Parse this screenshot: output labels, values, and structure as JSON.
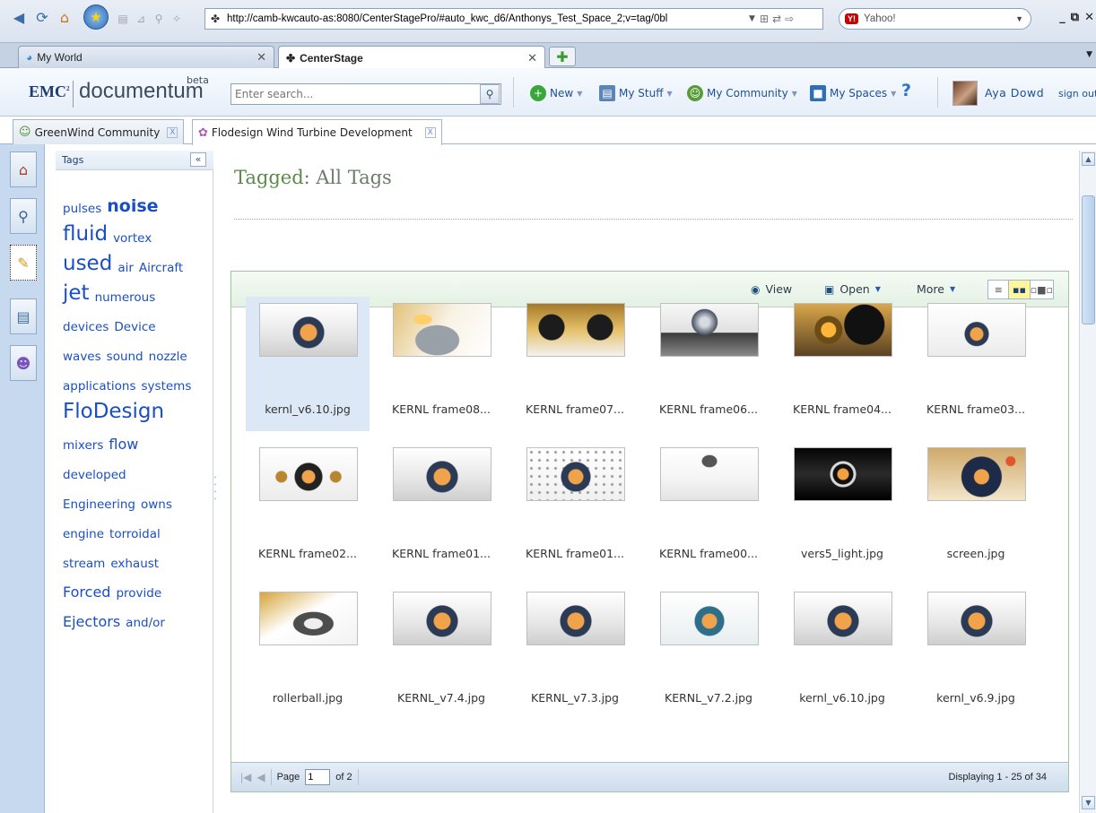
{
  "browser": {
    "url": "http://camb-kwcauto-as:8080/CenterStagePro/#auto_kwc_d6/Anthonys_Test_Space_2;v=tag/0bl",
    "search_engine": "Yahoo!",
    "window_controls": [
      "_",
      "⧉",
      "✕"
    ],
    "tabs": [
      {
        "label": "My World",
        "icon": "globe-icon",
        "active": false
      },
      {
        "label": "CenterStage",
        "icon": "centerstage-icon",
        "active": true
      }
    ]
  },
  "header": {
    "brand": "EMC",
    "brand_sup": "2",
    "product": "documentum",
    "badge": "beta",
    "search_placeholder": "Enter search...",
    "menus": [
      {
        "label": "New",
        "icon": "new-icon"
      },
      {
        "label": "My Stuff",
        "icon": "my-stuff-icon"
      },
      {
        "label": "My Community",
        "icon": "community-icon"
      },
      {
        "label": "My Spaces",
        "icon": "spaces-icon"
      }
    ],
    "help": "?",
    "user_name": "Aya Dowd",
    "sign_out": "sign out"
  },
  "space_tabs": [
    {
      "label": "GreenWind Community",
      "active": false
    },
    {
      "label": "Flodesign Wind Turbine Development",
      "active": true
    }
  ],
  "tags_panel": {
    "title": "Tags",
    "collapse": "«",
    "rows": [
      [
        {
          "t": "pulses",
          "s": "t-s"
        },
        {
          "t": "noise",
          "s": "t-l"
        }
      ],
      [
        {
          "t": "fluid",
          "s": "t-xl"
        },
        {
          "t": "vortex",
          "s": "t-s"
        }
      ],
      [
        {
          "t": "used",
          "s": "t-xl"
        },
        {
          "t": "air",
          "s": "t-s"
        },
        {
          "t": "Aircraft",
          "s": "t-s"
        }
      ],
      [
        {
          "t": "jet",
          "s": "t-xl"
        },
        {
          "t": "numerous",
          "s": "t-s"
        }
      ],
      [
        {
          "t": "devices",
          "s": "t-s"
        },
        {
          "t": "Device",
          "s": "t-s"
        }
      ],
      [
        {
          "t": "waves",
          "s": "t-s"
        },
        {
          "t": "sound",
          "s": "t-s"
        },
        {
          "t": "nozzle",
          "s": "t-s"
        }
      ],
      [
        {
          "t": "applications",
          "s": "t-s"
        },
        {
          "t": "systems",
          "s": "t-s"
        }
      ],
      [
        {
          "t": "FloDesign",
          "s": "t-xl"
        }
      ],
      [
        {
          "t": "mixers",
          "s": "t-s"
        },
        {
          "t": "flow",
          "s": "t-m"
        }
      ],
      [
        {
          "t": "developed",
          "s": "t-s"
        }
      ],
      [
        {
          "t": "Engineering",
          "s": "t-s"
        },
        {
          "t": "owns",
          "s": "t-s"
        }
      ],
      [
        {
          "t": "engine",
          "s": "t-s"
        },
        {
          "t": "torroidal",
          "s": "t-s"
        }
      ],
      [
        {
          "t": "stream",
          "s": "t-s"
        },
        {
          "t": "exhaust",
          "s": "t-s"
        }
      ],
      [
        {
          "t": "Forced",
          "s": "t-m"
        },
        {
          "t": "provide",
          "s": "t-s"
        }
      ],
      [
        {
          "t": "Ejectors",
          "s": "t-m"
        },
        {
          "t": "and/or",
          "s": "t-s"
        }
      ]
    ]
  },
  "main": {
    "title_key": "Tagged",
    "title_sep": ":",
    "title_value": "All Tags",
    "toolbar": {
      "view": "View",
      "open": "Open",
      "more": "More"
    },
    "items": [
      {
        "name": "kernl_v6.10.jpg",
        "selected": true,
        "style": "cube"
      },
      {
        "name": "KERNL frame08...",
        "style": "ball"
      },
      {
        "name": "KERNL frame07...",
        "style": "closeup"
      },
      {
        "name": "KERNL frame06...",
        "style": "sphere"
      },
      {
        "name": "KERNL frame04...",
        "style": "machine"
      },
      {
        "name": "KERNL frame03...",
        "style": "small"
      },
      {
        "name": "KERNL frame02...",
        "style": "winged"
      },
      {
        "name": "KERNL frame01...",
        "style": "cube"
      },
      {
        "name": "KERNL frame01...",
        "style": "debris"
      },
      {
        "name": "KERNL frame00...",
        "style": "tiny"
      },
      {
        "name": "vers5_light.jpg",
        "style": "dark"
      },
      {
        "name": "screen.jpg",
        "style": "screen"
      },
      {
        "name": "rollerball.jpg",
        "style": "roller"
      },
      {
        "name": "KERNL_v7.4.jpg",
        "style": "cube"
      },
      {
        "name": "KERNL_v7.3.jpg",
        "style": "cube"
      },
      {
        "name": "KERNL_v7.2.jpg",
        "style": "blue"
      },
      {
        "name": "kernl_v6.10.jpg",
        "style": "cube"
      },
      {
        "name": "kernl_v6.9.jpg",
        "style": "cube"
      }
    ],
    "pager": {
      "page_label": "Page",
      "page_value": "1",
      "of_label": "of 2",
      "display": "Displaying 1 - 25 of 34"
    }
  },
  "colors": {
    "link_blue": "#1a4fc4",
    "title_green": "#5b8a4a",
    "selected_bg": "#dde8f6",
    "toggle_selected": "#fff59a"
  }
}
